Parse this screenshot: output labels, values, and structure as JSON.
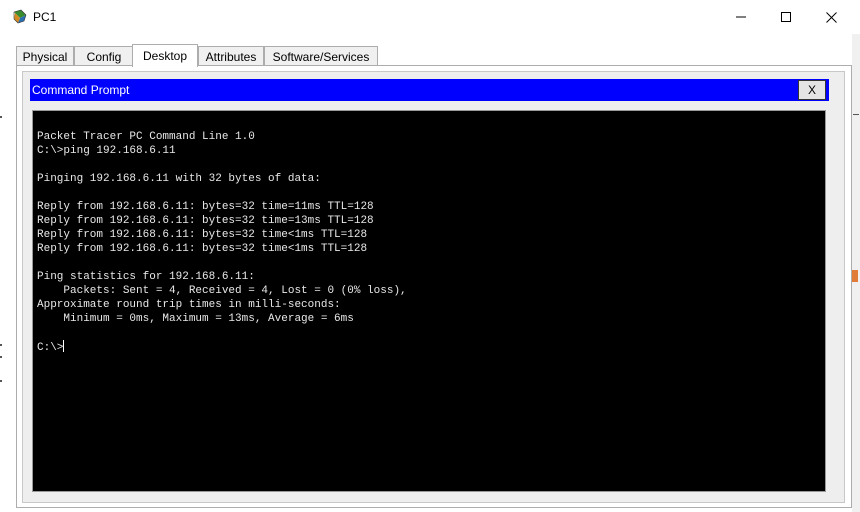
{
  "window": {
    "title": "PC1",
    "icon": "packet-tracer-pc-icon",
    "controls": {
      "minimize": "minimize-icon",
      "maximize": "maximize-icon",
      "close": "close-icon"
    }
  },
  "tabs": [
    {
      "label": "Physical",
      "active": false
    },
    {
      "label": "Config",
      "active": false
    },
    {
      "label": "Desktop",
      "active": true
    },
    {
      "label": "Attributes",
      "active": false
    },
    {
      "label": "Software/Services",
      "active": false
    }
  ],
  "command_prompt": {
    "title": "Command Prompt",
    "close_label": "X",
    "title_bar_color": "#0000ff",
    "background_color": "#000000",
    "text_color": "#e8e8e8",
    "lines": [
      "Packet Tracer PC Command Line 1.0",
      "C:\\>ping 192.168.6.11",
      "",
      "Pinging 192.168.6.11 with 32 bytes of data:",
      "",
      "Reply from 192.168.6.11: bytes=32 time=11ms TTL=128",
      "Reply from 192.168.6.11: bytes=32 time=13ms TTL=128",
      "Reply from 192.168.6.11: bytes=32 time<1ms TTL=128",
      "Reply from 192.168.6.11: bytes=32 time<1ms TTL=128",
      "",
      "Ping statistics for 192.168.6.11:",
      "    Packets: Sent = 4, Received = 4, Lost = 0 (0% loss),",
      "Approximate round trip times in milli-seconds:",
      "    Minimum = 0ms, Maximum = 13ms, Average = 6ms",
      ""
    ],
    "prompt": "C:\\>"
  }
}
